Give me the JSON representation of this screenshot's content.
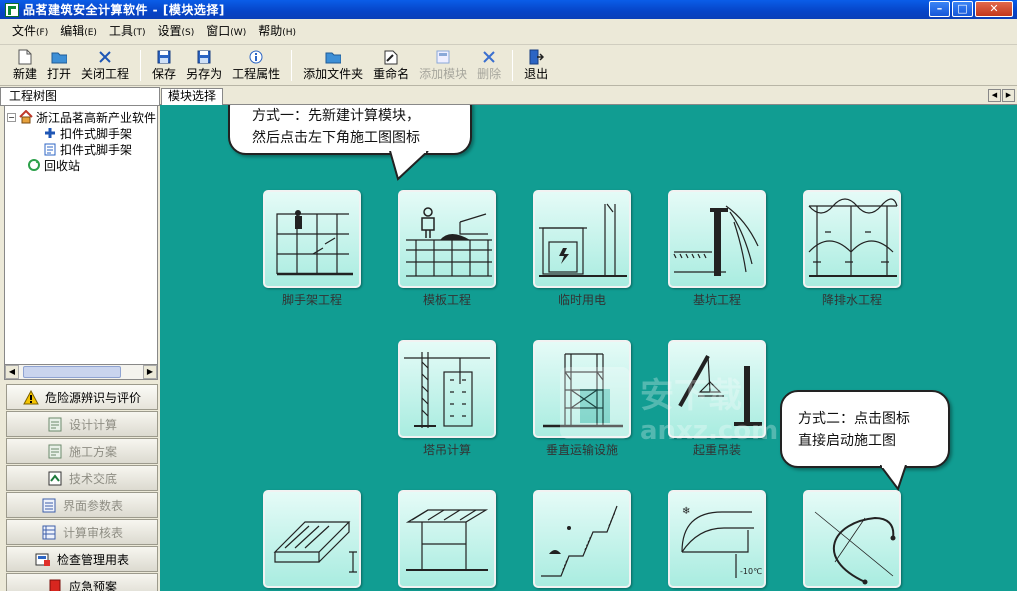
{
  "window": {
    "title": "品茗建筑安全计算软件 - [模块选择]",
    "controls": [
      "minimize",
      "maximize",
      "close"
    ]
  },
  "menu": [
    {
      "label": "文件",
      "hotkey": "(F)"
    },
    {
      "label": "编辑",
      "hotkey": "(E)"
    },
    {
      "label": "工具",
      "hotkey": "(T)"
    },
    {
      "label": "设置",
      "hotkey": "(S)"
    },
    {
      "label": "窗口",
      "hotkey": "(W)"
    },
    {
      "label": "帮助",
      "hotkey": "(H)"
    }
  ],
  "toolbar": {
    "new": "新建",
    "open": "打开",
    "close_project": "关闭工程",
    "save": "保存",
    "save_as": "另存为",
    "properties": "工程属性",
    "add_folder": "添加文件夹",
    "rename": "重命名",
    "add_module": "添加模块",
    "delete": "删除",
    "exit": "退出"
  },
  "tree": {
    "header": "工程树图",
    "root": "浙江品茗高新产业软件",
    "children": [
      "扣件式脚手架",
      "扣件式脚手架"
    ],
    "recycle": "回收站"
  },
  "nav": [
    {
      "label": "危险源辨识与评价",
      "icon": "warning-icon"
    },
    {
      "label": "设计计算",
      "icon": "calc-doc-icon"
    },
    {
      "label": "施工方案",
      "icon": "plan-doc-icon"
    },
    {
      "label": "技术交底",
      "icon": "disclosure-icon"
    },
    {
      "label": "界面参数表",
      "icon": "param-table-icon"
    },
    {
      "label": "计算审核表",
      "icon": "review-table-icon"
    },
    {
      "label": "检查管理用表",
      "icon": "inspection-icon"
    },
    {
      "label": "应急预案",
      "icon": "emergency-icon"
    }
  ],
  "tab": "模块选择",
  "modules": [
    {
      "label": "脚手架工程",
      "icon": "scaffold-icon"
    },
    {
      "label": "模板工程",
      "icon": "formwork-icon"
    },
    {
      "label": "临时用电",
      "icon": "temp-power-icon"
    },
    {
      "label": "基坑工程",
      "icon": "foundation-pit-icon"
    },
    {
      "label": "降排水工程",
      "icon": "dewatering-icon"
    },
    {
      "label": "塔吊计算",
      "icon": "tower-crane-icon"
    },
    {
      "label": "垂直运输设施",
      "icon": "vertical-transport-icon"
    },
    {
      "label": "起重吊装",
      "icon": "hoisting-icon"
    },
    {
      "label": "",
      "icon": "concrete-icon"
    },
    {
      "label": "",
      "icon": "steel-frame-icon"
    },
    {
      "label": "",
      "icon": "slope-icon"
    },
    {
      "label": "",
      "icon": "winter-icon"
    },
    {
      "label": "",
      "icon": "curve-icon"
    }
  ],
  "callouts": {
    "method1_line1": "方式一：先新建计算模块，",
    "method1_line2": "然后点击左下角施工图图标",
    "method2_line1": "方式二：点击图标",
    "method2_line2": "直接启动施工图"
  },
  "watermark": {
    "text1": "安下载",
    "text2": "anxz.com"
  }
}
